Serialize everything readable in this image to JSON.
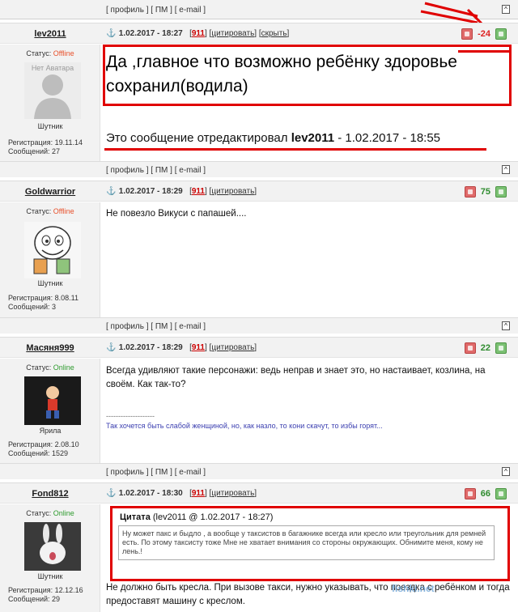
{
  "topbar": {
    "links": "[ профиль ] [ ПМ ] [ e-mail ]",
    "up": "[^]"
  },
  "posts": [
    {
      "nick": "lev2011",
      "date": "1.02.2017 - 18:27",
      "num": "911",
      "quote_label": "цитировать",
      "hide_label": "скрыть",
      "score": "-24",
      "status_label": "Статус: ",
      "status": "Offline",
      "avatar_text": "Нет Аватара",
      "rank": "Шутник",
      "reg": "Регистрация: 19.11.14",
      "msgs": "Сообщений: 27",
      "text": "Да ,главное что возможно ребёнку здоровье сохранил(водила)",
      "edit_prefix": "Это сообщение отредактировал ",
      "edit_user": "lev2011",
      "edit_time": " - 1.02.2017 - 18:55",
      "foot": "[ профиль ] [ ПМ ] [ e-mail ]",
      "up": "[^]"
    },
    {
      "nick": "Goldwarrior",
      "date": "1.02.2017 - 18:29",
      "num": "911",
      "quote_label": "цитировать",
      "score": "75",
      "status_label": "Статус: ",
      "status": "Offline",
      "rank": "Шутник",
      "reg": "Регистрация: 8.08.11",
      "msgs": "Сообщений: 3",
      "text": "Не повезло Викуси с папашей....",
      "foot": "[ профиль ] [ ПМ ] [ e-mail ]",
      "up": "[^]"
    },
    {
      "nick": "Масяня999",
      "date": "1.02.2017 - 18:29",
      "num": "911",
      "quote_label": "цитировать",
      "score": "22",
      "status_label": "Статус: ",
      "status": "Online",
      "rank": "Ярила",
      "reg": "Регистрация: 2.08.10",
      "msgs": "Сообщений: 1529",
      "text": "Всегда удивляют такие персонажи: ведь неправ и знает это, но настаивает, козлина, на своём. Как так-то?",
      "sig_sep": "--------------------",
      "signature": "Так хочется быть слабой женщиной, но, как назло, то кони скачут, то избы горят...",
      "foot": "[ профиль ] [ ПМ ] [ e-mail ]",
      "up": "[^]"
    },
    {
      "nick": "Fond812",
      "date": "1.02.2017 - 18:30",
      "num": "911",
      "quote_label": "цитировать",
      "score": "66",
      "status_label": "Статус: ",
      "status": "Online",
      "rank": "Шутник",
      "reg": "Регистрация: 12.12.16",
      "msgs": "Сообщений: 29",
      "quote_title": "Цитата",
      "quote_src": " (lev2011 @ 1.02.2017 - 18:27)",
      "quote_text": "Ну может пакс и быдло , а вообще у таксистов в багажнике всегда или кресло или треугольник для ремней есть. По этому таксисту тоже Мне не хватает внимания со стороны окружающих. Обнимите меня, кому не лень.!",
      "text": "Не должно быть кресла. При вызове такси, нужно указывать, что поездка с ребёнком и тогда предоставят машину с креслом."
    }
  ],
  "watermark": "fishki.net",
  "colors": {
    "annotation_red": "#e00000",
    "offline": "#e8502a",
    "online": "#2e9b2e",
    "negative": "#d22222",
    "positive": "#2e8b2e"
  }
}
